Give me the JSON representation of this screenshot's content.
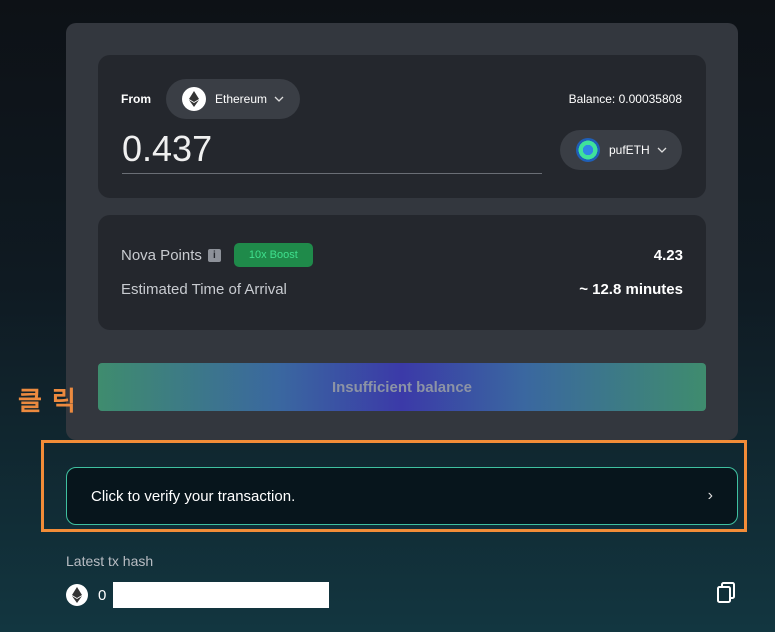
{
  "from": {
    "label": "From",
    "chain": "Ethereum",
    "balance": "Balance: 0.00035808",
    "amount": "0.437",
    "token": "pufETH"
  },
  "points": {
    "nova_label": "Nova Points",
    "boost_label": "10x Boost",
    "nova_value": "4.23",
    "eta_label": "Estimated Time of Arrival",
    "eta_value": "~ 12.8 minutes"
  },
  "action": {
    "button_label": "Insufficient balance"
  },
  "annotation": {
    "korean_label": "클릭",
    "highlight_color": "#f28c38"
  },
  "verify": {
    "text": "Click to verify your transaction.",
    "arrow": "›"
  },
  "latest": {
    "label": "Latest tx hash",
    "hash_prefix": "0"
  },
  "icons": [
    "ethereum-icon",
    "chevron-down-icon",
    "pufeth-token-icon",
    "info-icon",
    "chevron-right-icon",
    "copy-icon"
  ]
}
